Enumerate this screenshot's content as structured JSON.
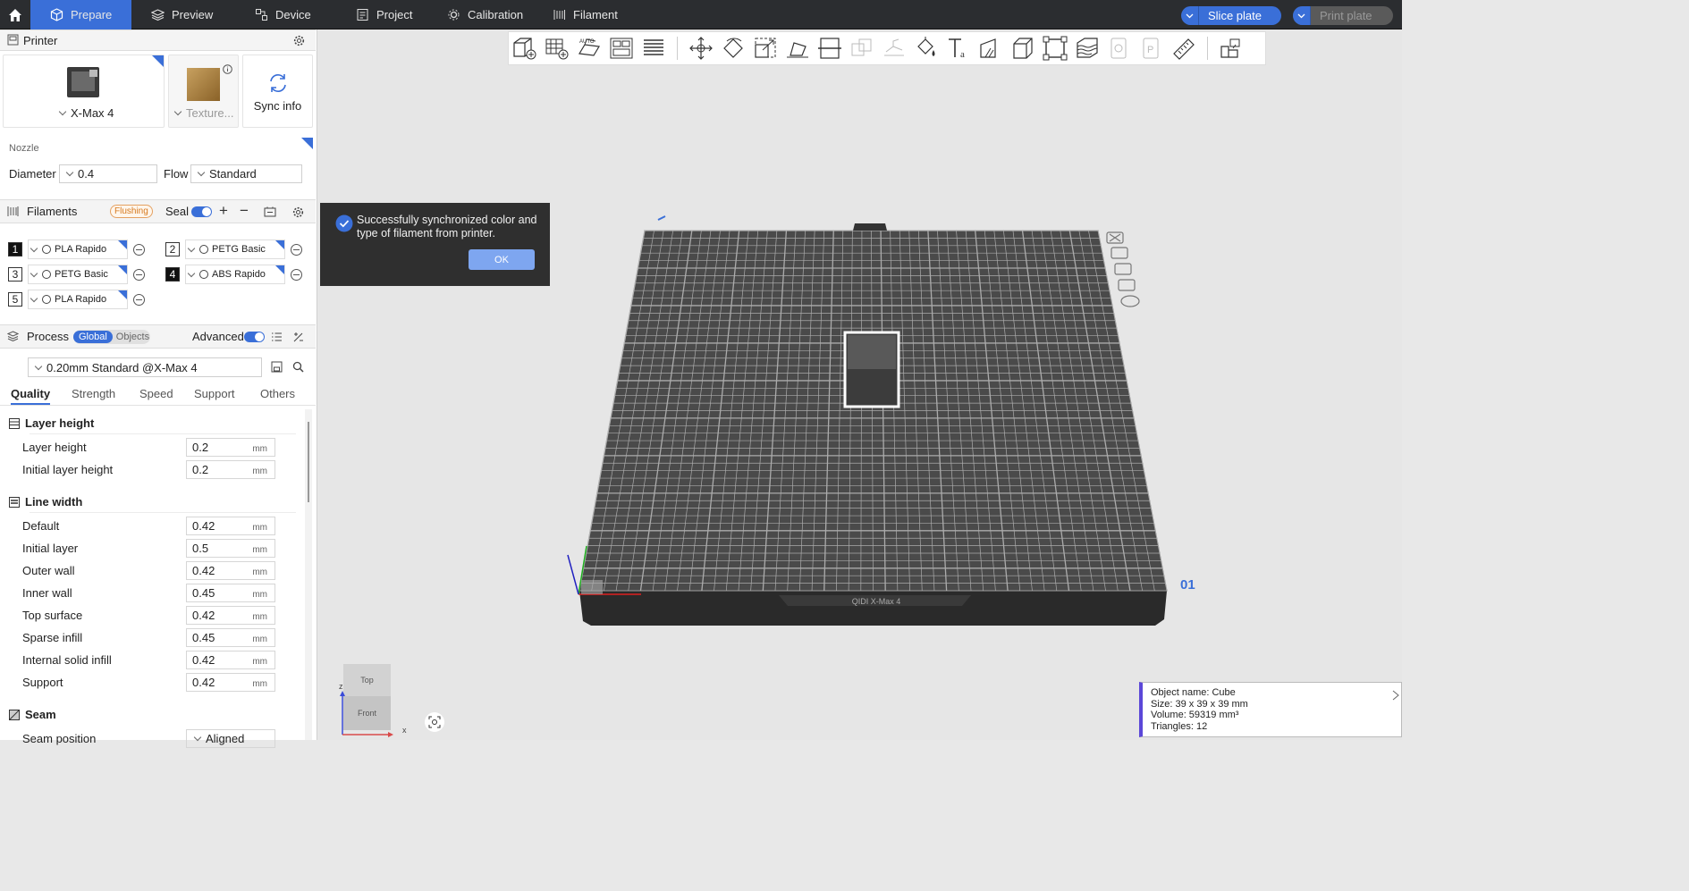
{
  "topbar": {
    "tabs": [
      {
        "label": "Prepare",
        "icon": "cube-icon"
      },
      {
        "label": "Preview",
        "icon": "layers-icon"
      },
      {
        "label": "Device",
        "icon": "device-icon"
      },
      {
        "label": "Project",
        "icon": "project-icon"
      },
      {
        "label": "Calibration",
        "icon": "calibration-icon"
      },
      {
        "label": "Filament",
        "icon": "filament-icon"
      }
    ],
    "slice_label": "Slice plate",
    "print_label": "Print plate",
    "accent": "#3a6fd8"
  },
  "printer": {
    "title": "Printer",
    "model": "X-Max 4",
    "texture": "Texture...",
    "sync": "Sync info",
    "nozzle_label": "Nozzle",
    "diameter_label": "Diameter",
    "diameter": "0.4",
    "flow_label": "Flow",
    "flow": "Standard"
  },
  "filaments": {
    "title": "Filaments",
    "badge": "Flushing",
    "seal": "Seal",
    "items": [
      {
        "num": "1",
        "name": "PLA Rapido"
      },
      {
        "num": "2",
        "name": "PETG Basic"
      },
      {
        "num": "3",
        "name": "PETG Basic"
      },
      {
        "num": "4",
        "name": "ABS Rapido"
      },
      {
        "num": "5",
        "name": "PLA Rapido"
      }
    ]
  },
  "process": {
    "title": "Process",
    "global": "Global",
    "objects": "Objects",
    "advanced": "Advanced",
    "preset": "0.20mm Standard @X-Max 4",
    "tabs": [
      "Quality",
      "Strength",
      "Speed",
      "Support",
      "Others"
    ],
    "sections": {
      "layer_height": "Layer height",
      "line_width": "Line width",
      "seam": "Seam"
    },
    "layer_rows": [
      {
        "label": "Layer height",
        "value": "0.2",
        "unit": "mm"
      },
      {
        "label": "Initial layer height",
        "value": "0.2",
        "unit": "mm"
      }
    ],
    "line_rows": [
      {
        "label": "Default",
        "value": "0.42",
        "unit": "mm"
      },
      {
        "label": "Initial layer",
        "value": "0.5",
        "unit": "mm"
      },
      {
        "label": "Outer wall",
        "value": "0.42",
        "unit": "mm"
      },
      {
        "label": "Inner wall",
        "value": "0.45",
        "unit": "mm"
      },
      {
        "label": "Top surface",
        "value": "0.42",
        "unit": "mm"
      },
      {
        "label": "Sparse infill",
        "value": "0.45",
        "unit": "mm"
      },
      {
        "label": "Internal solid infill",
        "value": "0.42",
        "unit": "mm"
      },
      {
        "label": "Support",
        "value": "0.42",
        "unit": "mm"
      }
    ],
    "seam_row": {
      "label": "Seam position",
      "value": "Aligned"
    }
  },
  "toast": {
    "message": "Successfully synchronized color and type of filament from printer.",
    "ok": "OK"
  },
  "plate": {
    "number": "01",
    "brand": "QIDI  X-Max 4"
  },
  "viewcube": {
    "top": "Top",
    "front": "Front",
    "z": "z",
    "x": "x"
  },
  "object_info": {
    "name": "Object name: Cube",
    "size": "Size: 39 x 39 x 39 mm",
    "volume": "Volume: 59319 mm³",
    "triangles": "Triangles: 12"
  }
}
